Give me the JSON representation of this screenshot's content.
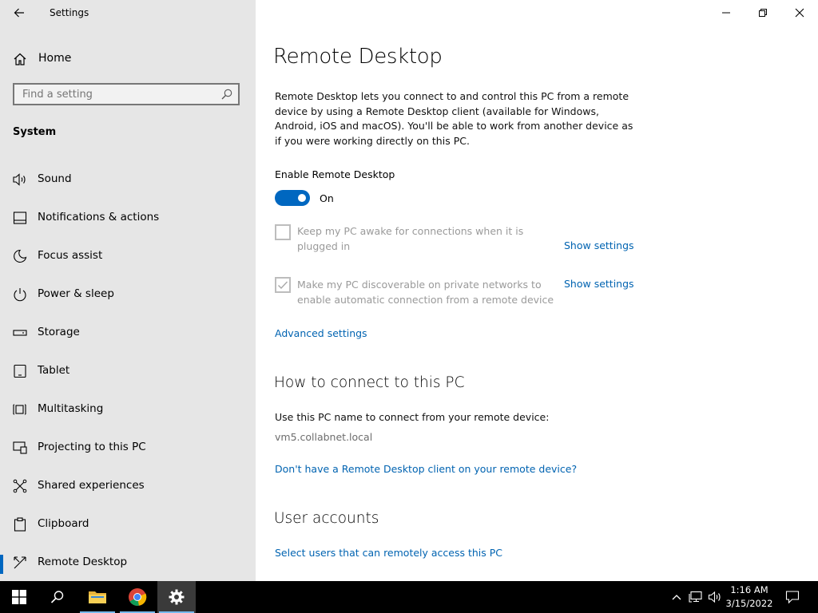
{
  "window": {
    "title": "Settings"
  },
  "sidebar": {
    "home_label": "Home",
    "search_placeholder": "Find a setting",
    "section_title": "System",
    "items": [
      {
        "label": "Sound",
        "icon": "speaker-icon"
      },
      {
        "label": "Notifications & actions",
        "icon": "notifications-icon"
      },
      {
        "label": "Focus assist",
        "icon": "moon-icon"
      },
      {
        "label": "Power & sleep",
        "icon": "power-icon"
      },
      {
        "label": "Storage",
        "icon": "storage-icon"
      },
      {
        "label": "Tablet",
        "icon": "tablet-icon"
      },
      {
        "label": "Multitasking",
        "icon": "multitasking-icon"
      },
      {
        "label": "Projecting to this PC",
        "icon": "projecting-icon"
      },
      {
        "label": "Shared experiences",
        "icon": "shared-experiences-icon"
      },
      {
        "label": "Clipboard",
        "icon": "clipboard-icon"
      },
      {
        "label": "Remote Desktop",
        "icon": "remote-desktop-icon",
        "active": true
      }
    ]
  },
  "main": {
    "title": "Remote Desktop",
    "description": "Remote Desktop lets you connect to and control this PC from a remote device by using a Remote Desktop client (available for Windows, Android, iOS and macOS). You'll be able to work from another device as if you were working directly on this PC.",
    "enable_label": "Enable Remote Desktop",
    "toggle_state": "On",
    "toggle_on": true,
    "option1": {
      "label": "Keep my PC awake for connections when it is plugged in",
      "checked": false,
      "link": "Show settings"
    },
    "option2": {
      "label": "Make my PC discoverable on private networks to enable automatic connection from a remote device",
      "checked": true,
      "link": "Show settings"
    },
    "advanced_link": "Advanced settings",
    "connect_heading": "How to connect to this PC",
    "connect_text": "Use this PC name to connect from your remote device:",
    "pc_name": "vm5.collabnet.local",
    "client_link": "Don't have a Remote Desktop client on your remote device?",
    "accounts_heading": "User accounts",
    "accounts_link": "Select users that can remotely access this PC"
  },
  "taskbar": {
    "time": "1:16 AM",
    "date": "3/15/2022"
  },
  "colors": {
    "accent": "#0067c0",
    "link": "#0063b1",
    "sidebar_bg": "#e6e6e6",
    "taskbar_bg": "#000000"
  }
}
